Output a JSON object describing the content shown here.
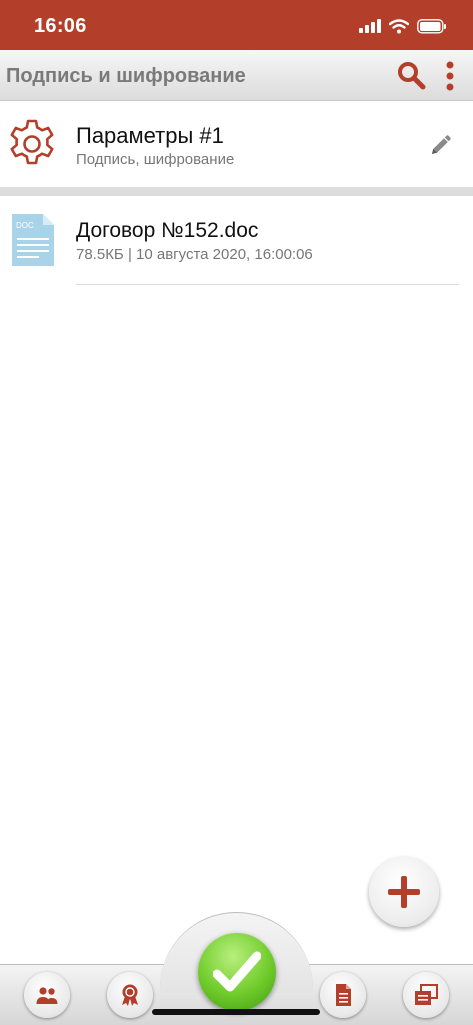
{
  "status_bar": {
    "time": "16:06"
  },
  "app_bar": {
    "title": "Подпись и шифрование"
  },
  "params": {
    "title": "Параметры #1",
    "subtitle": "Подпись, шифрование"
  },
  "files": [
    {
      "name": "Договор №152.doc",
      "meta": "78.5КБ | 10 августа 2020, 16:00:06",
      "icon_label": "DOC"
    }
  ],
  "colors": {
    "accent": "#b33f2a",
    "confirm": "#6fcb2a",
    "file_icon": "#a9d3e8"
  },
  "icons": {
    "search": "search-icon",
    "more": "more-vertical-icon",
    "params": "gear-icon",
    "edit": "pencil-icon",
    "file": "doc-file-icon",
    "add": "plus-icon",
    "tab1": "users-icon",
    "tab2": "certificate-icon",
    "confirm": "checkmark-icon",
    "tab4": "document-icon",
    "tab5": "documents-stack-icon"
  }
}
